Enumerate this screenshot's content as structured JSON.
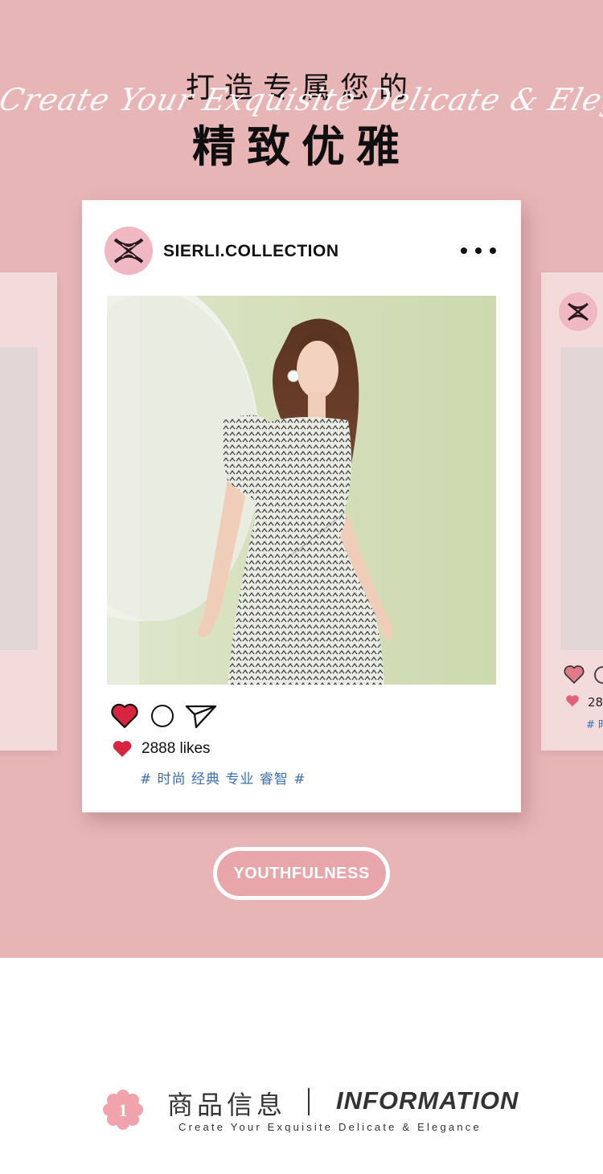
{
  "header": {
    "title_top": "打造专属您的",
    "script_text": "Create Your Exquisite Delicate & Elegance",
    "title_main": "精致优雅"
  },
  "post": {
    "username": "SIERLI.COLLECTION",
    "likes_text": "2888 likes",
    "hashtags": "# 时尚 经典 专业 睿智 #",
    "avatar_icon": "sierli-logo-icon",
    "colors": {
      "like_red": "#d8253f",
      "avatar_pink": "#f0b8c2",
      "tag_blue": "#3a6fb5"
    }
  },
  "side_card_right": {
    "likes_partial": "28",
    "tag_partial": "# 时"
  },
  "cta": {
    "label": "YOUTHFULNESS"
  },
  "info_section": {
    "badge_number": "1",
    "title_cn": "商品信息",
    "title_en": "INFORMATION",
    "subtitle": "Create Your Exquisite Delicate & Elegance"
  },
  "theme": {
    "background_pink": "#e8b5b7",
    "white": "#ffffff"
  }
}
